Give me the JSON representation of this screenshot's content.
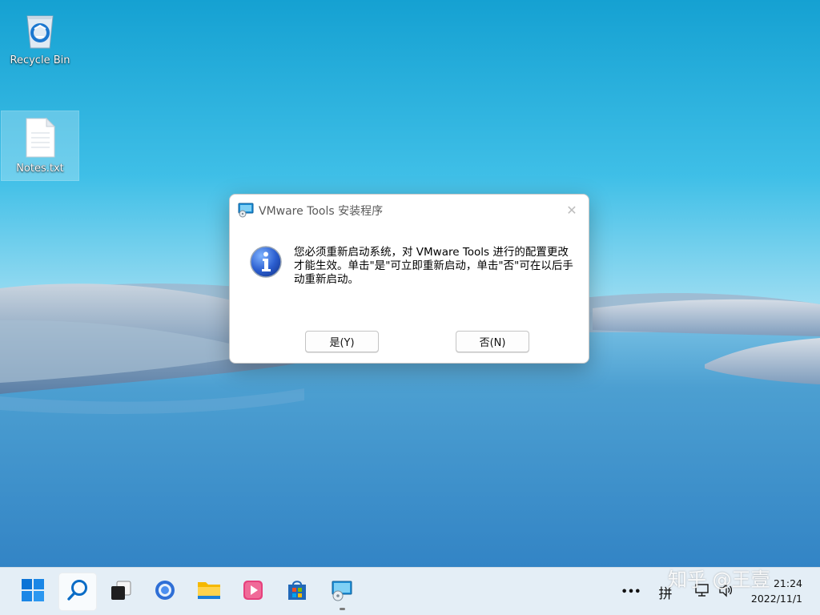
{
  "desktop": {
    "icons": [
      {
        "label": "Recycle Bin",
        "icon": "recycle-bin-icon"
      },
      {
        "label": "Notes.txt",
        "icon": "text-file-icon"
      }
    ]
  },
  "dialog": {
    "title": "VMware Tools 安装程序",
    "icon": "info-icon",
    "message": "您必须重新启动系统，对 VMware Tools 进行的配置更改才能生效。单击\"是\"可立即重新启动，单击\"否\"可在以后手动重新启动。",
    "yes_label": "是(Y)",
    "no_label": "否(N)"
  },
  "taskbar": {
    "apps": [
      {
        "name": "start",
        "icon": "windows-start-icon"
      },
      {
        "name": "search",
        "icon": "search-icon",
        "active": true
      },
      {
        "name": "task-view",
        "icon": "task-view-icon"
      },
      {
        "name": "browser",
        "icon": "browser-icon"
      },
      {
        "name": "file-explorer",
        "icon": "folder-icon"
      },
      {
        "name": "media-player",
        "icon": "media-player-icon"
      },
      {
        "name": "store",
        "icon": "store-icon"
      },
      {
        "name": "vmware-tools-setup",
        "icon": "vmware-setup-icon",
        "running": true
      }
    ],
    "tray": {
      "overflow": "•••",
      "ime": "拼",
      "network_icon": "network-icon",
      "volume_icon": "volume-icon"
    },
    "clock": {
      "time": "21:24",
      "date": "2022/11/1"
    }
  },
  "watermark": "知乎 @王壹",
  "colors": {
    "accent": "#0067c0",
    "taskbar": "#e4eef6",
    "dialog_bg": "#ffffff"
  }
}
